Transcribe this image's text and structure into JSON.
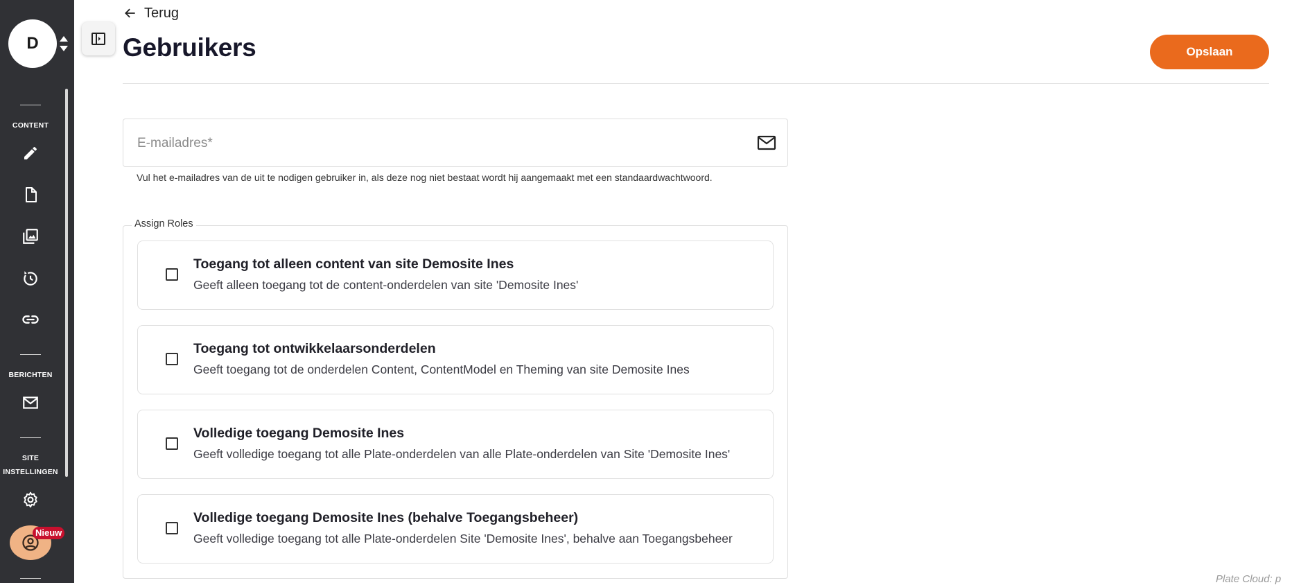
{
  "sidebar": {
    "avatar_initial": "D",
    "sections": {
      "content": "CONTENT",
      "berichten": "BERICHTEN",
      "site_line1": "SITE",
      "site_line2": "INSTELLINGEN"
    },
    "icons": [
      "edit-icon",
      "document-icon",
      "images-icon",
      "history-icon",
      "link-icon",
      "mail-icon",
      "settings-icon",
      "user-account-icon"
    ],
    "new_badge": "Nieuw"
  },
  "header": {
    "back_label": "Terug",
    "title": "Gebruikers",
    "save_label": "Opslaan"
  },
  "email": {
    "placeholder": "E-mailadres*",
    "value": "",
    "helper": "Vul het e-mailadres van de uit te nodigen gebruiker in, als deze nog niet bestaat wordt hij aangemaakt met een standaardwachtwoord."
  },
  "roles": {
    "legend": "Assign Roles",
    "items": [
      {
        "title": "Toegang tot alleen content van site Demosite Ines",
        "description": "Geeft alleen toegang tot de content-onderdelen van site 'Demosite Ines'",
        "checked": false
      },
      {
        "title": "Toegang tot ontwikkelaarsonderdelen",
        "description": "Geeft toegang tot de onderdelen Content, ContentModel en Theming van site Demosite Ines",
        "checked": false
      },
      {
        "title": "Volledige toegang Demosite Ines",
        "description": "Geeft volledige toegang tot alle Plate-onderdelen van alle Plate-onderdelen van Site 'Demosite Ines'",
        "checked": false
      },
      {
        "title": "Volledige toegang Demosite Ines (behalve Toegangsbeheer)",
        "description": "Geeft volledige toegang tot alle Plate-onderdelen Site 'Demosite Ines', behalve aan Toegangsbeheer",
        "checked": false
      }
    ]
  },
  "footer": {
    "note": "Plate Cloud: p"
  },
  "colors": {
    "sidebar_bg": "#303135",
    "accent": "#ea6a1d",
    "badge": "#c8102e"
  }
}
